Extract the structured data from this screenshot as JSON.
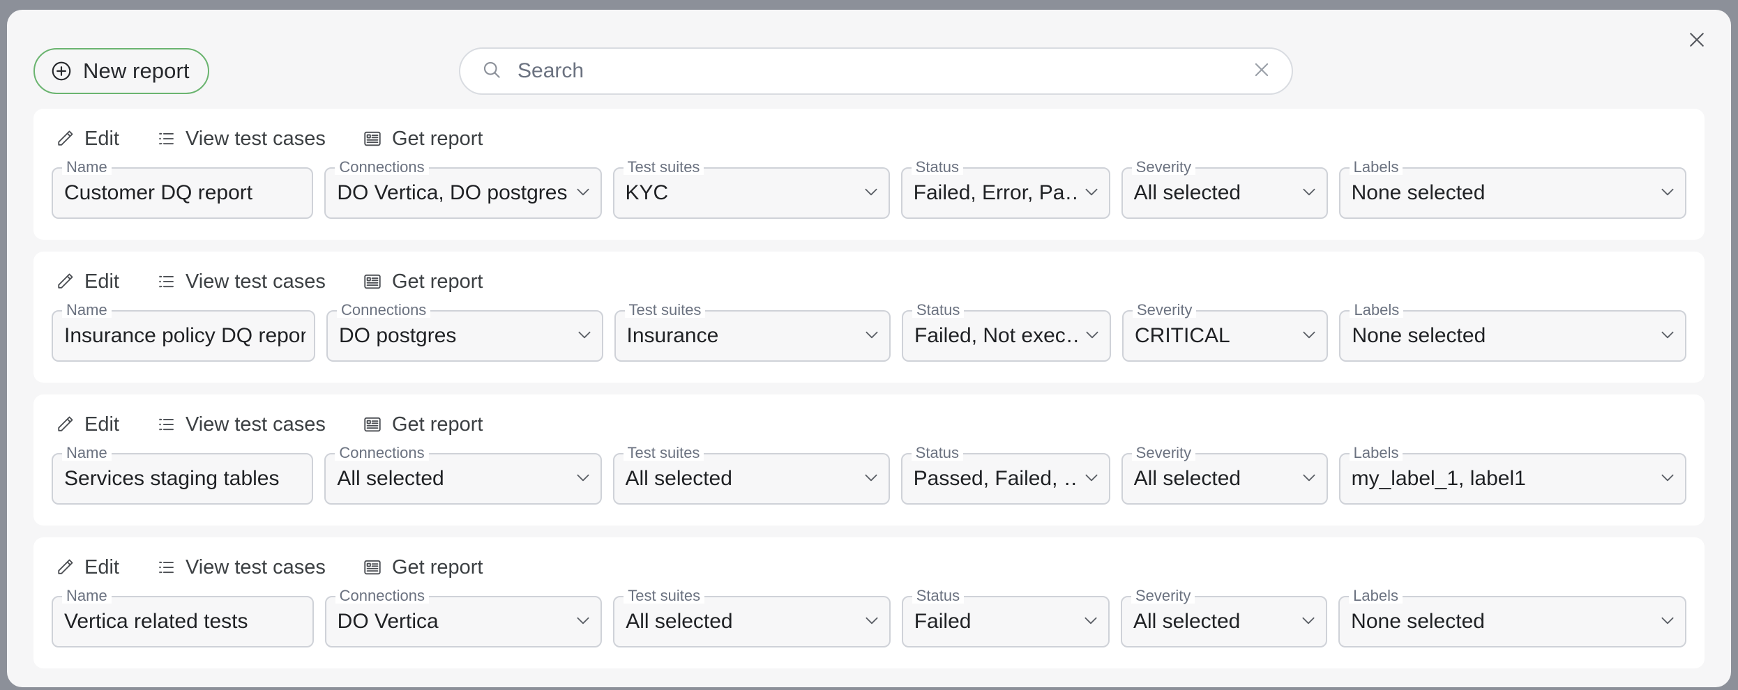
{
  "window": {
    "close_label": "×",
    "close_icon": "close-icon"
  },
  "toolbar": {
    "new_report_label": "New report",
    "new_report_icon": "plus-circle-icon",
    "new_report_border_color": "#6ab46f"
  },
  "search": {
    "placeholder": "Search",
    "value": "",
    "search_icon": "search-icon",
    "clear_icon": "clear-icon"
  },
  "actions": {
    "edit": {
      "label": "Edit",
      "icon": "pencil-icon"
    },
    "view_test_cases": {
      "label": "View test cases",
      "icon": "list-icon"
    },
    "get_report": {
      "label": "Get report",
      "icon": "article-icon"
    }
  },
  "field_labels": {
    "name": "Name",
    "connections": "Connections",
    "test_suites": "Test suites",
    "status": "Status",
    "severity": "Severity",
    "labels": "Labels"
  },
  "reports": [
    {
      "name": "Customer DQ report",
      "connections": "DO Vertica, DO postgres",
      "test_suites": "KYC",
      "status": "Failed, Error, Pa…",
      "severity": "All selected",
      "labels": "None selected"
    },
    {
      "name": "Insurance policy DQ report",
      "connections": "DO postgres",
      "test_suites": "Insurance",
      "status": "Failed, Not exec…",
      "severity": "CRITICAL",
      "labels": "None selected"
    },
    {
      "name": "Services staging tables",
      "connections": "All selected",
      "test_suites": "All selected",
      "status": "Passed, Failed, …",
      "severity": "All selected",
      "labels": "my_label_1, label1"
    },
    {
      "name": "Vertica related tests",
      "connections": "DO Vertica",
      "test_suites": "All selected",
      "status": "Failed",
      "severity": "All selected",
      "labels": "None selected"
    }
  ]
}
